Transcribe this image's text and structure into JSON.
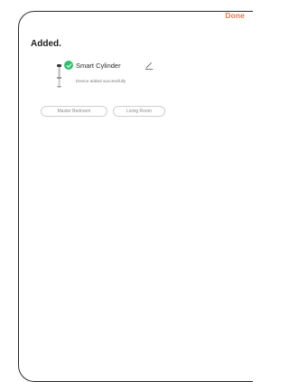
{
  "header": {
    "done_label": "Done"
  },
  "page": {
    "title": "Added."
  },
  "device": {
    "name": "Smart Cylinder",
    "status": "Device added successfully",
    "icon": "cylinder-lock-icon",
    "badge_icon": "check-icon",
    "edit_icon": "pencil-icon"
  },
  "rooms": [
    {
      "label": "Master Bedroom"
    },
    {
      "label": "Living Room"
    }
  ],
  "colors": {
    "accent": "#e8784a",
    "success": "#2fbf6a",
    "border": "#2a2a2a"
  }
}
